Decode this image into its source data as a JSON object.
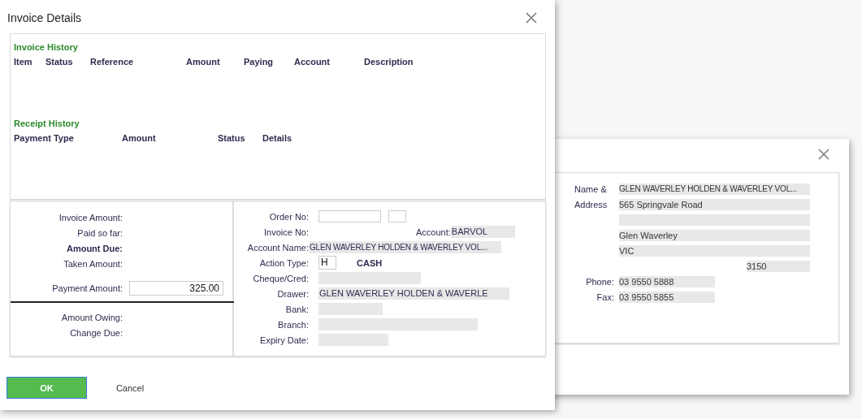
{
  "invoice_dialog": {
    "title": "Invoice Details",
    "invoice_history": {
      "title": "Invoice History",
      "columns": [
        "Item",
        "Status",
        "Reference",
        "Amount",
        "Paying",
        "Account",
        "Description"
      ]
    },
    "receipt_history": {
      "title": "Receipt History",
      "columns": [
        "Payment Type",
        "Amount",
        "Status",
        "Details"
      ]
    },
    "summary": [
      {
        "label": "Invoice Amount:",
        "bold": false
      },
      {
        "label": "Paid so far:",
        "bold": false
      },
      {
        "label": "Amount Due:",
        "bold": true
      },
      {
        "label": "Taken Amount:",
        "bold": false
      }
    ],
    "payment": {
      "label": "Payment Amount:",
      "value": "325.00"
    },
    "totals": [
      {
        "label": "Amount Owing:",
        "bold": false
      },
      {
        "label": "Change Due:",
        "bold": false
      }
    ],
    "details": [
      {
        "kind": "order",
        "label": "Order No:"
      },
      {
        "kind": "account",
        "label": "Invoice No:",
        "account_label": "Account:",
        "account_value": "BARVOL"
      },
      {
        "kind": "wide",
        "label": "Account Name:",
        "value": "GLEN WAVERLEY HOLDEN & WAVERLEY VOL..."
      },
      {
        "kind": "code",
        "label": "Action Type:",
        "value": "H",
        "note": "CASH"
      },
      {
        "kind": "field",
        "label": "Cheque/Cred:"
      },
      {
        "kind": "field",
        "label": "Drawer:",
        "value": "GLEN WAVERLEY HOLDEN & WAVERLE"
      },
      {
        "kind": "field",
        "label": "Bank:"
      },
      {
        "kind": "field",
        "label": "Branch:"
      },
      {
        "kind": "field",
        "label": "Expiry Date:"
      }
    ],
    "buttons": [
      {
        "label": "OK",
        "kind": "primary"
      },
      {
        "label": "Cancel",
        "kind": "plain"
      }
    ]
  },
  "address_dialog": {
    "rows": [
      {
        "kind": "line",
        "label": "Name &",
        "value": "GLEN WAVERLEY HOLDEN & WAVERLEY VOL..."
      },
      {
        "kind": "line",
        "label": "Address",
        "value": "565 Springvale Road"
      },
      {
        "kind": "line"
      },
      {
        "kind": "line",
        "value": "Glen Waverley"
      },
      {
        "kind": "line",
        "value": "VIC"
      },
      {
        "kind": "postcode",
        "value": "3150"
      },
      {
        "kind": "phone",
        "label": "Phone:",
        "value": "03 9550 5888"
      },
      {
        "kind": "phone",
        "label": "Fax:",
        "value": "03 9550 5855"
      }
    ]
  }
}
